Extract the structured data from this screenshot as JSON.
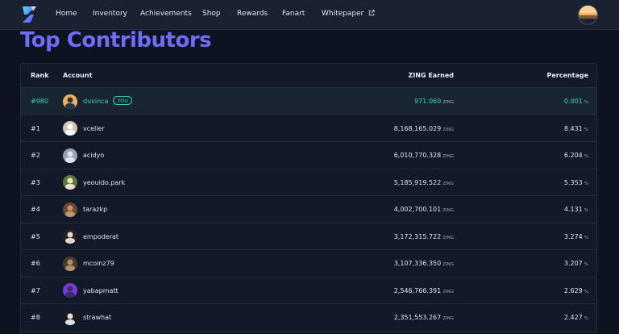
{
  "nav": {
    "items": [
      {
        "label": "Home"
      },
      {
        "label": "Inventory"
      },
      {
        "label": "Achievements"
      },
      {
        "label": "Shop"
      },
      {
        "label": "Rewards"
      },
      {
        "label": "Fanart"
      },
      {
        "label": "Whitepaper",
        "external": true
      }
    ],
    "logo_icon": "zing-logo-icon",
    "avatar_icon": "user-avatar"
  },
  "page": {
    "title": "Top Contributors"
  },
  "table": {
    "headers": {
      "rank": "Rank",
      "account": "Account",
      "earned": "ZING Earned",
      "percentage": "Percentage"
    },
    "unit_token": "ZING",
    "unit_pct": "%",
    "you_badge": "YOU",
    "rows": [
      {
        "rank": "#980",
        "account": "duvinca",
        "earned": "971.060",
        "pct": "0.001",
        "you": true
      },
      {
        "rank": "#1",
        "account": "vcelier",
        "earned": "8,168,165.029",
        "pct": "8.431"
      },
      {
        "rank": "#2",
        "account": "acidyo",
        "earned": "6,010,770.328",
        "pct": "6.204"
      },
      {
        "rank": "#3",
        "account": "yeouido.park",
        "earned": "5,185,919.522",
        "pct": "5.353"
      },
      {
        "rank": "#4",
        "account": "tarazkp",
        "earned": "4,002,700.101",
        "pct": "4.131"
      },
      {
        "rank": "#5",
        "account": "empoderat",
        "earned": "3,172,315.722",
        "pct": "3.274"
      },
      {
        "rank": "#6",
        "account": "mcoinz79",
        "earned": "3,107,336.350",
        "pct": "3.207"
      },
      {
        "rank": "#7",
        "account": "yabapmatt",
        "earned": "2,546,766.391",
        "pct": "2.629"
      },
      {
        "rank": "#8",
        "account": "strawhat",
        "earned": "2,351,553.267",
        "pct": "2.427"
      }
    ]
  },
  "colors": {
    "accent": "#6f6cf6",
    "highlight": "#35d4a4",
    "background": "#0d1320"
  }
}
